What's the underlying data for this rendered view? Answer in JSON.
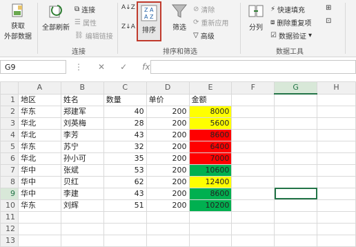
{
  "ribbon": {
    "get_external": [
      "获取",
      "外部数据"
    ],
    "refresh_all": "全部刷新",
    "connections": {
      "connect": "连接",
      "properties": "属性",
      "edit_links": "编辑链接"
    },
    "group_connections": "连接",
    "sort": "排序",
    "filter": "筛选",
    "clear": "清除",
    "reapply": "重新应用",
    "advanced": "高级",
    "group_sort_filter": "排序和筛选",
    "text_to_columns": "分列",
    "flash_fill": "快速填充",
    "remove_duplicates": "删除重复项",
    "data_validation": "数据验证",
    "group_data_tools": "数据工具"
  },
  "formula_bar": {
    "name_box": "G9",
    "fx": "fx"
  },
  "columns": [
    "A",
    "B",
    "C",
    "D",
    "E",
    "F",
    "G",
    "H"
  ],
  "rows": [
    {
      "n": "1",
      "cells": [
        "地区",
        "姓名",
        "数量",
        "单价",
        "金额"
      ]
    },
    {
      "n": "2",
      "cells": [
        "华东",
        "郑建军",
        "40",
        "200",
        "8000"
      ],
      "fill": "y"
    },
    {
      "n": "3",
      "cells": [
        "华北",
        "刘英梅",
        "28",
        "200",
        "5600"
      ],
      "fill": "y"
    },
    {
      "n": "4",
      "cells": [
        "华北",
        "李芳",
        "43",
        "200",
        "8600"
      ],
      "fill": "r"
    },
    {
      "n": "5",
      "cells": [
        "华东",
        "苏宁",
        "32",
        "200",
        "6400"
      ],
      "fill": "r"
    },
    {
      "n": "6",
      "cells": [
        "华北",
        "孙小可",
        "35",
        "200",
        "7000"
      ],
      "fill": "r"
    },
    {
      "n": "7",
      "cells": [
        "华中",
        "张斌",
        "53",
        "200",
        "10600"
      ],
      "fill": "g"
    },
    {
      "n": "8",
      "cells": [
        "华中",
        "贝红",
        "62",
        "200",
        "12400"
      ],
      "fill": "y"
    },
    {
      "n": "9",
      "cells": [
        "华中",
        "李建",
        "43",
        "200",
        "8600"
      ],
      "fill": "g"
    },
    {
      "n": "10",
      "cells": [
        "华东",
        "刘辉",
        "51",
        "200",
        "10200"
      ],
      "fill": "g"
    },
    {
      "n": "11",
      "cells": []
    },
    {
      "n": "12",
      "cells": []
    },
    {
      "n": "13",
      "cells": []
    }
  ],
  "colors": {
    "yellow": "#ffff00",
    "red": "#ff0000",
    "green": "#00b050",
    "accent": "#217346",
    "sort_highlight": "#c0392b"
  }
}
